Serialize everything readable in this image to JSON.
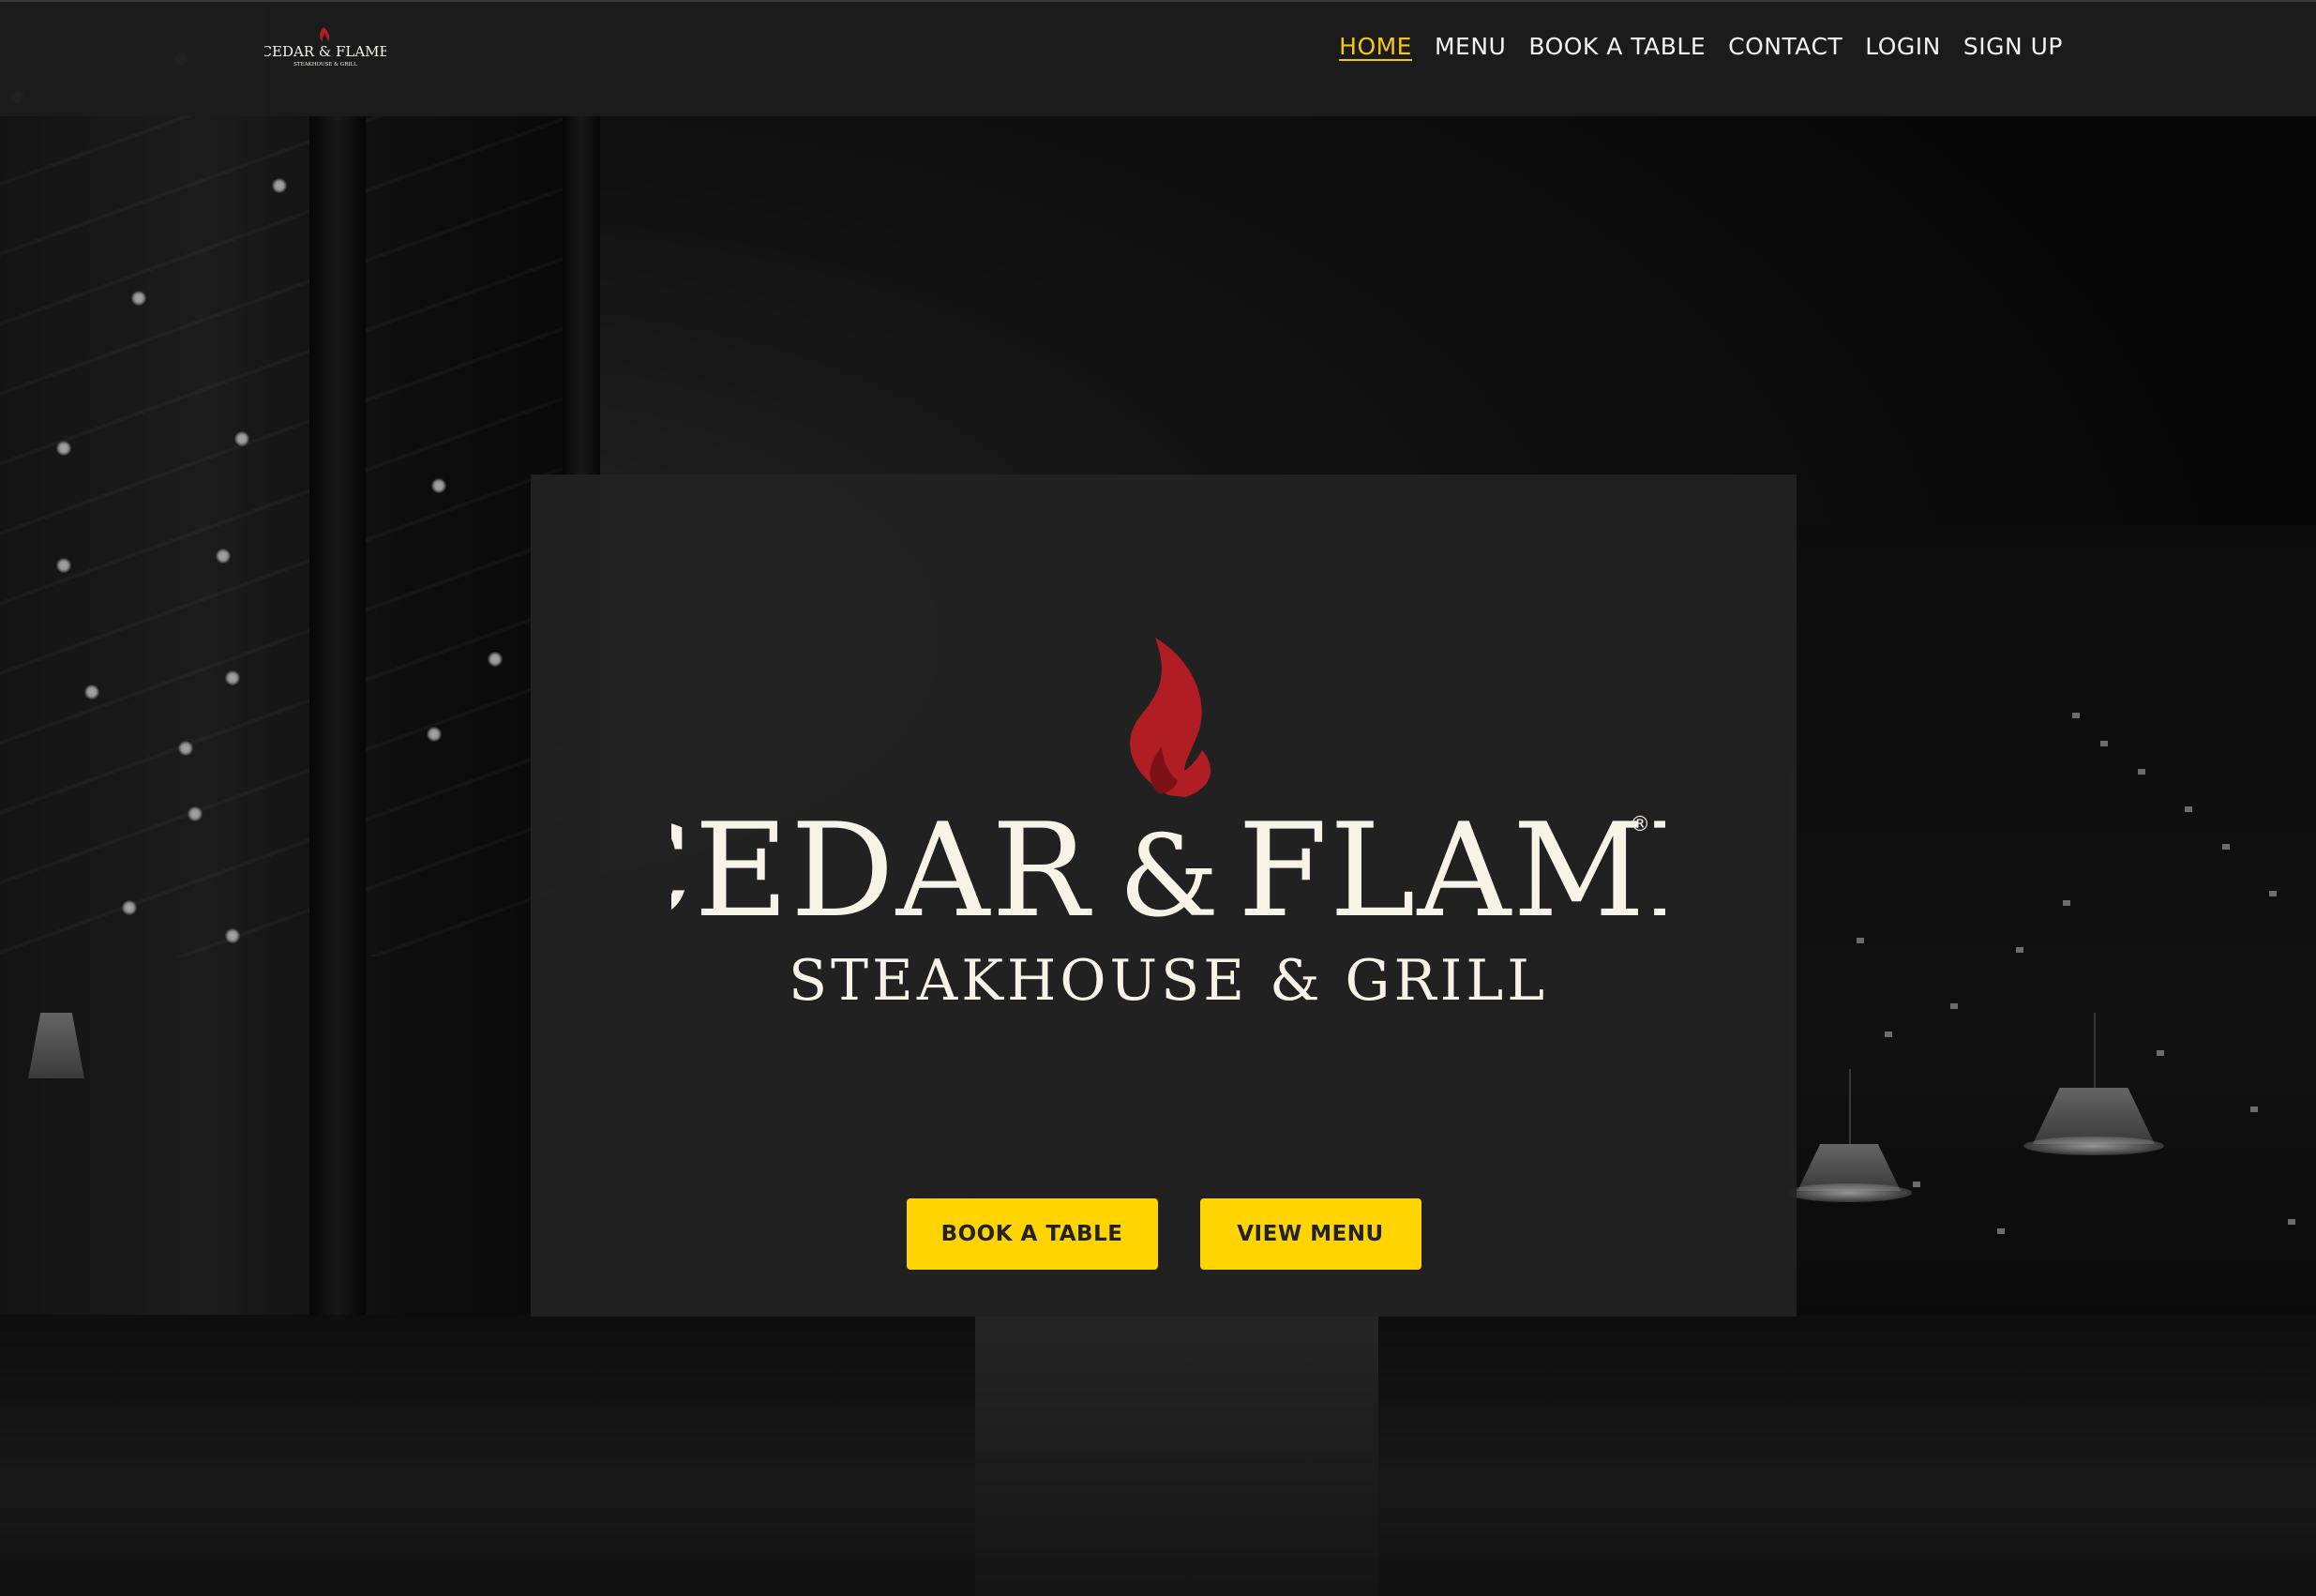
{
  "brand": {
    "name": "CEDAR & FLAME",
    "name_primary": "CEDAR",
    "name_amp": "&",
    "name_secondary": "FLAME",
    "registered_mark": "®",
    "tagline": "STEAKHOUSE & GRILL",
    "flame_color": "#b01e23",
    "wordmark_color": "#f7f3e6"
  },
  "header": {
    "nav": [
      {
        "label": "HOME",
        "active": true
      },
      {
        "label": "MENU",
        "active": false
      },
      {
        "label": "BOOK A TABLE",
        "active": false
      },
      {
        "label": "CONTACT",
        "active": false
      },
      {
        "label": "LOGIN",
        "active": false
      },
      {
        "label": "SIGN UP",
        "active": false
      }
    ],
    "active_color": "#f5c518"
  },
  "hero": {
    "buttons": {
      "book_label": "BOOK A TABLE",
      "menu_label": "VIEW MENU"
    },
    "button_color": "#ffd400"
  }
}
